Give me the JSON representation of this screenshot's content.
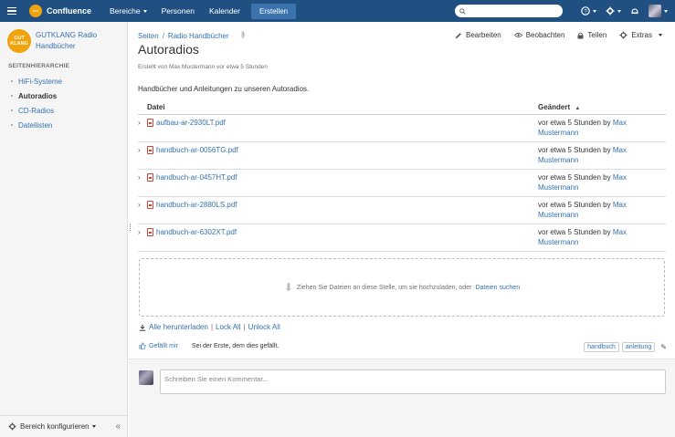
{
  "topbar": {
    "brand": "Confluence",
    "logo_text": "GUT",
    "nav": [
      {
        "label": "Bereiche",
        "dropdown": true
      },
      {
        "label": "Personen",
        "dropdown": false
      },
      {
        "label": "Kalender",
        "dropdown": false
      }
    ],
    "create_label": "Erstellen",
    "search_placeholder": ""
  },
  "sidebar": {
    "logo_line1": "GUT",
    "logo_line2": "KLANG",
    "space_name": "GUTKLANG Radio Handbücher",
    "heading": "SEITENHIERARCHIE",
    "items": [
      {
        "label": "HiFi-Systeme",
        "active": false
      },
      {
        "label": "Autoradios",
        "active": true
      },
      {
        "label": "CD-Radios",
        "active": false
      },
      {
        "label": "Dateilisten",
        "active": false
      }
    ],
    "footer_label": "Bereich konfigurieren"
  },
  "breadcrumb": [
    "Seiten",
    "Radio Handbücher"
  ],
  "actions": {
    "edit": "Bearbeiten",
    "watch": "Beobachten",
    "share": "Teilen",
    "extras": "Extras"
  },
  "page": {
    "title": "Autoradios",
    "byline": "Erstellt von Max Mustermann vor etwa 5 Stunden",
    "intro": "Handbücher und Anleitungen zu unseren Autoradios."
  },
  "files": {
    "col_file": "Datei",
    "col_changed": "Geändert",
    "rows": [
      {
        "name": "aufbau-ar-2930LT.pdf",
        "changed_prefix": "vor etwa 5 Stunden by",
        "author": "Max Mustermann"
      },
      {
        "name": "handbuch-ar-0056TG.pdf",
        "changed_prefix": "vor etwa 5 Stunden by",
        "author": "Max Mustermann"
      },
      {
        "name": "handbuch-ar-0457HT.pdf",
        "changed_prefix": "vor etwa 5 Stunden by",
        "author": "Max Mustermann"
      },
      {
        "name": "handbuch-ar-2880LS.pdf",
        "changed_prefix": "vor etwa 5 Stunden by",
        "author": "Max Mustermann"
      },
      {
        "name": "handbuch-ar-6302XT.pdf",
        "changed_prefix": "vor etwa 5 Stunden by",
        "author": "Max Mustermann"
      }
    ]
  },
  "dropzone": {
    "text": "Ziehen Sie Dateien an diese Stelle, um sie hochzuladen, oder",
    "link": "Dateien suchen"
  },
  "downloads": {
    "all": "Alle herunterladen",
    "lock": "Lock All",
    "unlock": "Unlock All"
  },
  "likes": {
    "button": "Gefällt mir",
    "text": "Sei der Erste, dem dies gefällt."
  },
  "labels": [
    "handbuch",
    "anleitung"
  ],
  "comment": {
    "placeholder": "Schreiben Sie einen Kommentar..."
  },
  "colors": {
    "header": "#205081",
    "link": "#3572b0",
    "create_button": "#3b73af",
    "logo": "#f0a30a"
  }
}
